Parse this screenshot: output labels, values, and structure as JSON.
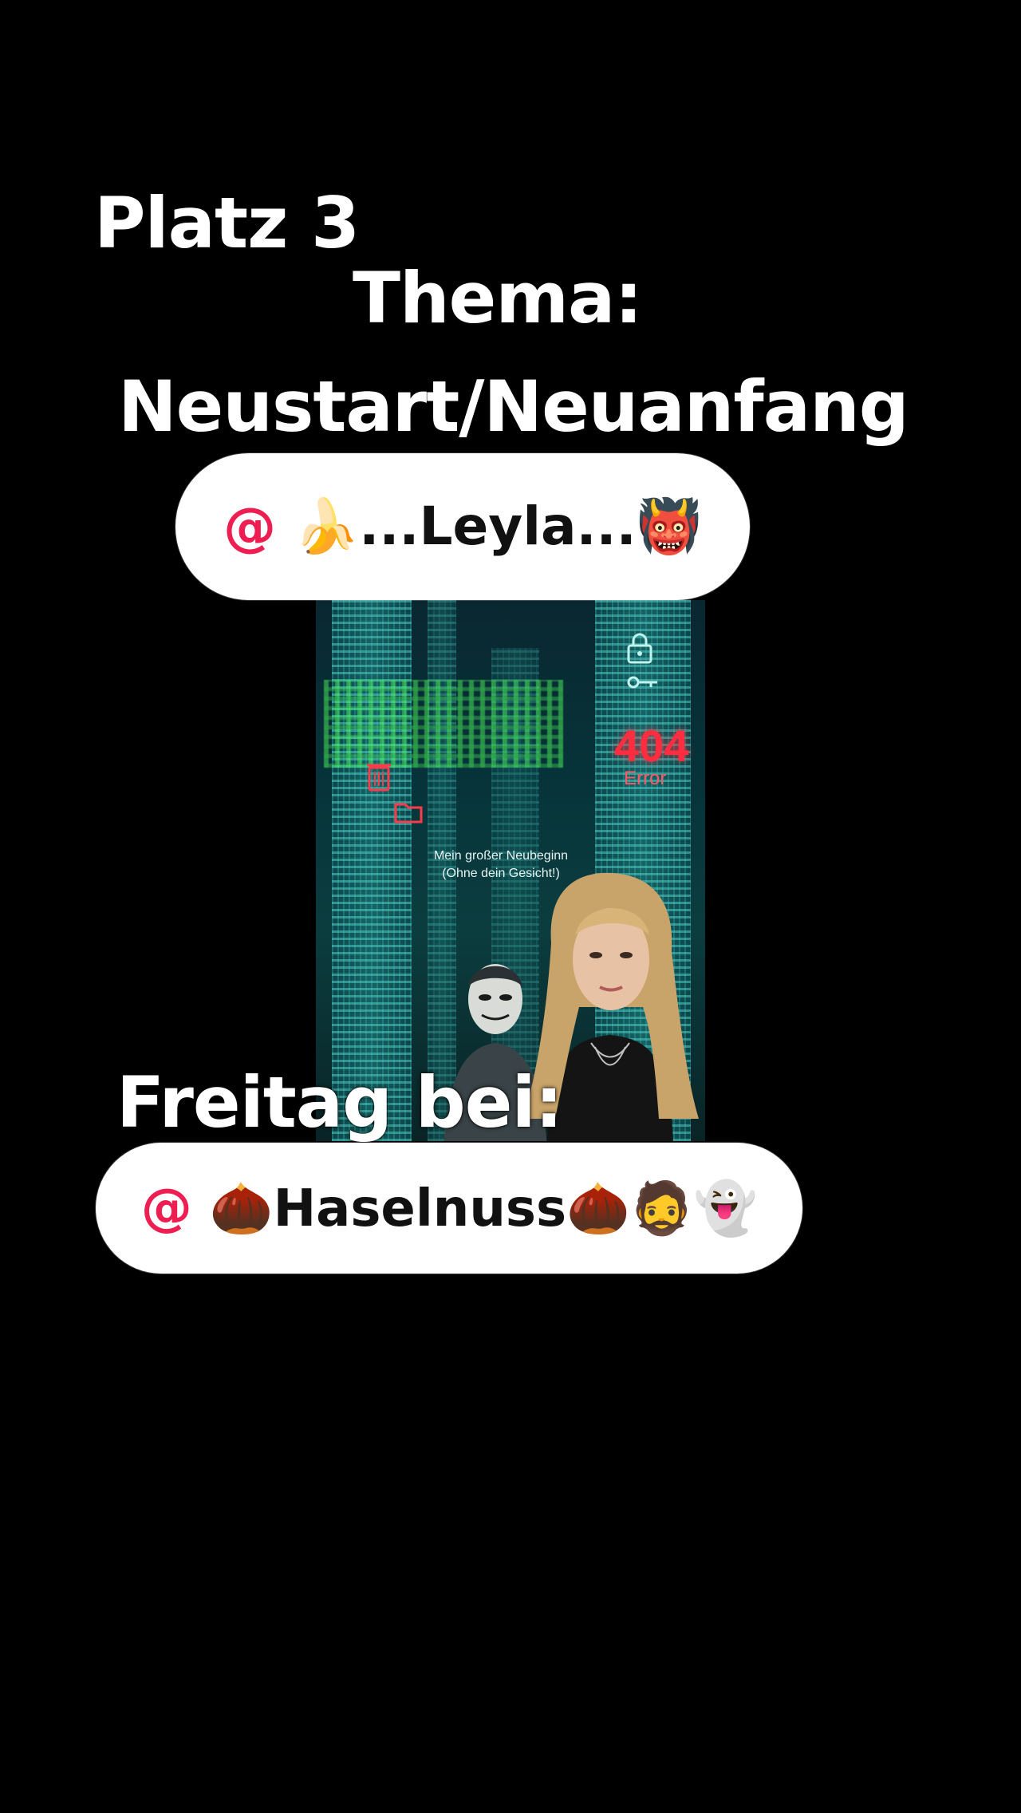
{
  "overlay": {
    "rank": "Platz 3",
    "topic_label": "Thema:",
    "topic_value": "Neustart/Neuanfang",
    "friday_label": "Freitag bei:"
  },
  "mentions": [
    {
      "at": "@",
      "name": "🍌...Leyla...👹"
    },
    {
      "at": "@",
      "name": "🌰Haselnuss🌰🧔👻"
    }
  ],
  "video": {
    "error_code": "404",
    "error_label": "Error",
    "caption_line1": "Mein großer Neubeginn",
    "caption_line2": "(Ohne dein Gesicht!)"
  },
  "colors": {
    "background": "#000000",
    "mention_bubble": "#ffffff",
    "mention_at": "#ee1d52",
    "error_red": "#ff2d3f"
  }
}
